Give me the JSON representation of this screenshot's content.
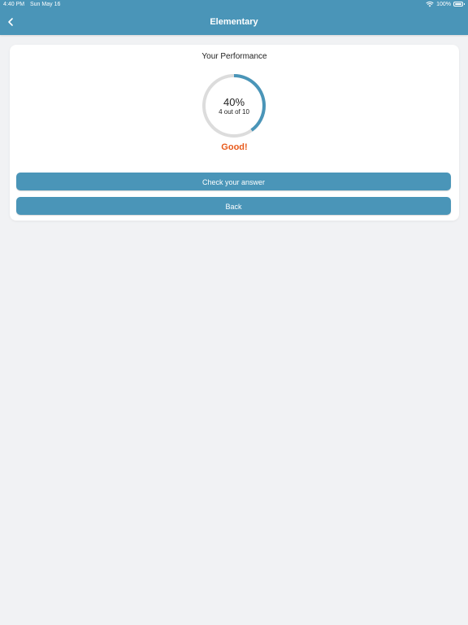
{
  "status_bar": {
    "time": "4:40 PM",
    "date": "Sun May 16",
    "battery": "100%",
    "wifi_icon": "wifi-icon",
    "battery_icon": "battery-icon"
  },
  "nav": {
    "title": "Elementary",
    "back_icon": "chevron-left-icon"
  },
  "performance": {
    "title": "Your Performance",
    "percent_label": "40%",
    "progress_fraction": 0.4,
    "count_label": "4 out of 10",
    "verdict": "Good!"
  },
  "buttons": {
    "check_answer": "Check your answer",
    "back": "Back"
  },
  "colors": {
    "primary": "#4a95b8",
    "ring_track": "#dcdcdc",
    "verdict": "#e85a1b",
    "background": "#f1f2f4"
  }
}
